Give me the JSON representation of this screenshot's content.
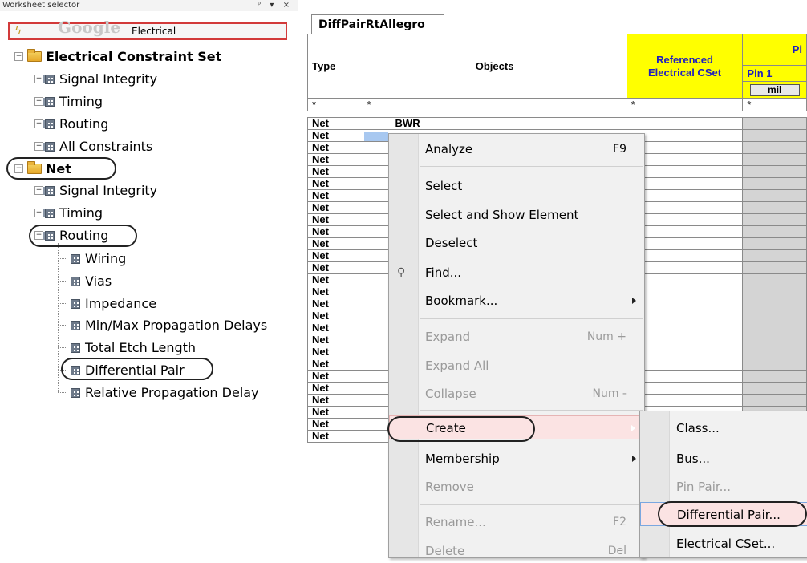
{
  "window": {
    "panel_title": "Worksheet selector",
    "panel_buttons": "ᵖ ▾ ×"
  },
  "selector": {
    "logo_text": "Google",
    "value": "Electrical"
  },
  "tree": {
    "ecs_root": "Electrical Constraint Set",
    "ecs_children": [
      "Signal Integrity",
      "Timing",
      "Routing",
      "All Constraints"
    ],
    "net_root": "Net",
    "net_children": [
      "Signal Integrity",
      "Timing",
      "Routing"
    ],
    "routing_children": [
      "Wiring",
      "Vias",
      "Impedance",
      "Min/Max Propagation Delays",
      "Total Etch Length",
      "Differential Pair",
      "Relative Propagation Delay"
    ]
  },
  "worksheet": {
    "tab": "DiffPairRtAllegro",
    "headers": {
      "type": "Type",
      "objects": "Objects",
      "ref_cset_1": "Referenced",
      "ref_cset_2": "Electrical CSet",
      "pin_group": "Pi",
      "pin1": "Pin 1",
      "unit": "mil"
    },
    "filter_row": [
      "*",
      "*",
      "*",
      "*"
    ],
    "first_object": "BWR",
    "row_type": "Net",
    "row_count": 27
  },
  "context_menu": {
    "items": [
      {
        "label": "Analyze",
        "shortcut": "F9",
        "disabled": false
      },
      {
        "label": "Select",
        "shortcut": "",
        "disabled": false
      },
      {
        "label": "Select and Show Element",
        "shortcut": "",
        "disabled": false
      },
      {
        "label": "Deselect",
        "shortcut": "",
        "disabled": false
      },
      {
        "label": "Find...",
        "shortcut": "",
        "disabled": false
      },
      {
        "label": "Bookmark...",
        "shortcut": "",
        "disabled": false
      },
      {
        "label": "Expand",
        "shortcut": "Num +",
        "disabled": true
      },
      {
        "label": "Expand All",
        "shortcut": "",
        "disabled": true
      },
      {
        "label": "Collapse",
        "shortcut": "Num -",
        "disabled": true
      },
      {
        "label": "Create",
        "shortcut": "",
        "disabled": false
      },
      {
        "label": "Membership",
        "shortcut": "",
        "disabled": false
      },
      {
        "label": "Remove",
        "shortcut": "",
        "disabled": true
      },
      {
        "label": "Rename...",
        "shortcut": "F2",
        "disabled": true
      },
      {
        "label": "Delete",
        "shortcut": "Del",
        "disabled": true
      }
    ]
  },
  "submenu": {
    "items": [
      {
        "label": "Class...",
        "disabled": false
      },
      {
        "label": "Bus...",
        "disabled": false
      },
      {
        "label": "Pin Pair...",
        "disabled": true
      },
      {
        "label": "Differential Pair...",
        "disabled": false
      },
      {
        "label": "Electrical CSet...",
        "disabled": false
      }
    ]
  },
  "colors": {
    "header_yellow": "#ffff00",
    "header_text_blue": "#1f1fbf",
    "highlight_red": "#d23a3a"
  }
}
